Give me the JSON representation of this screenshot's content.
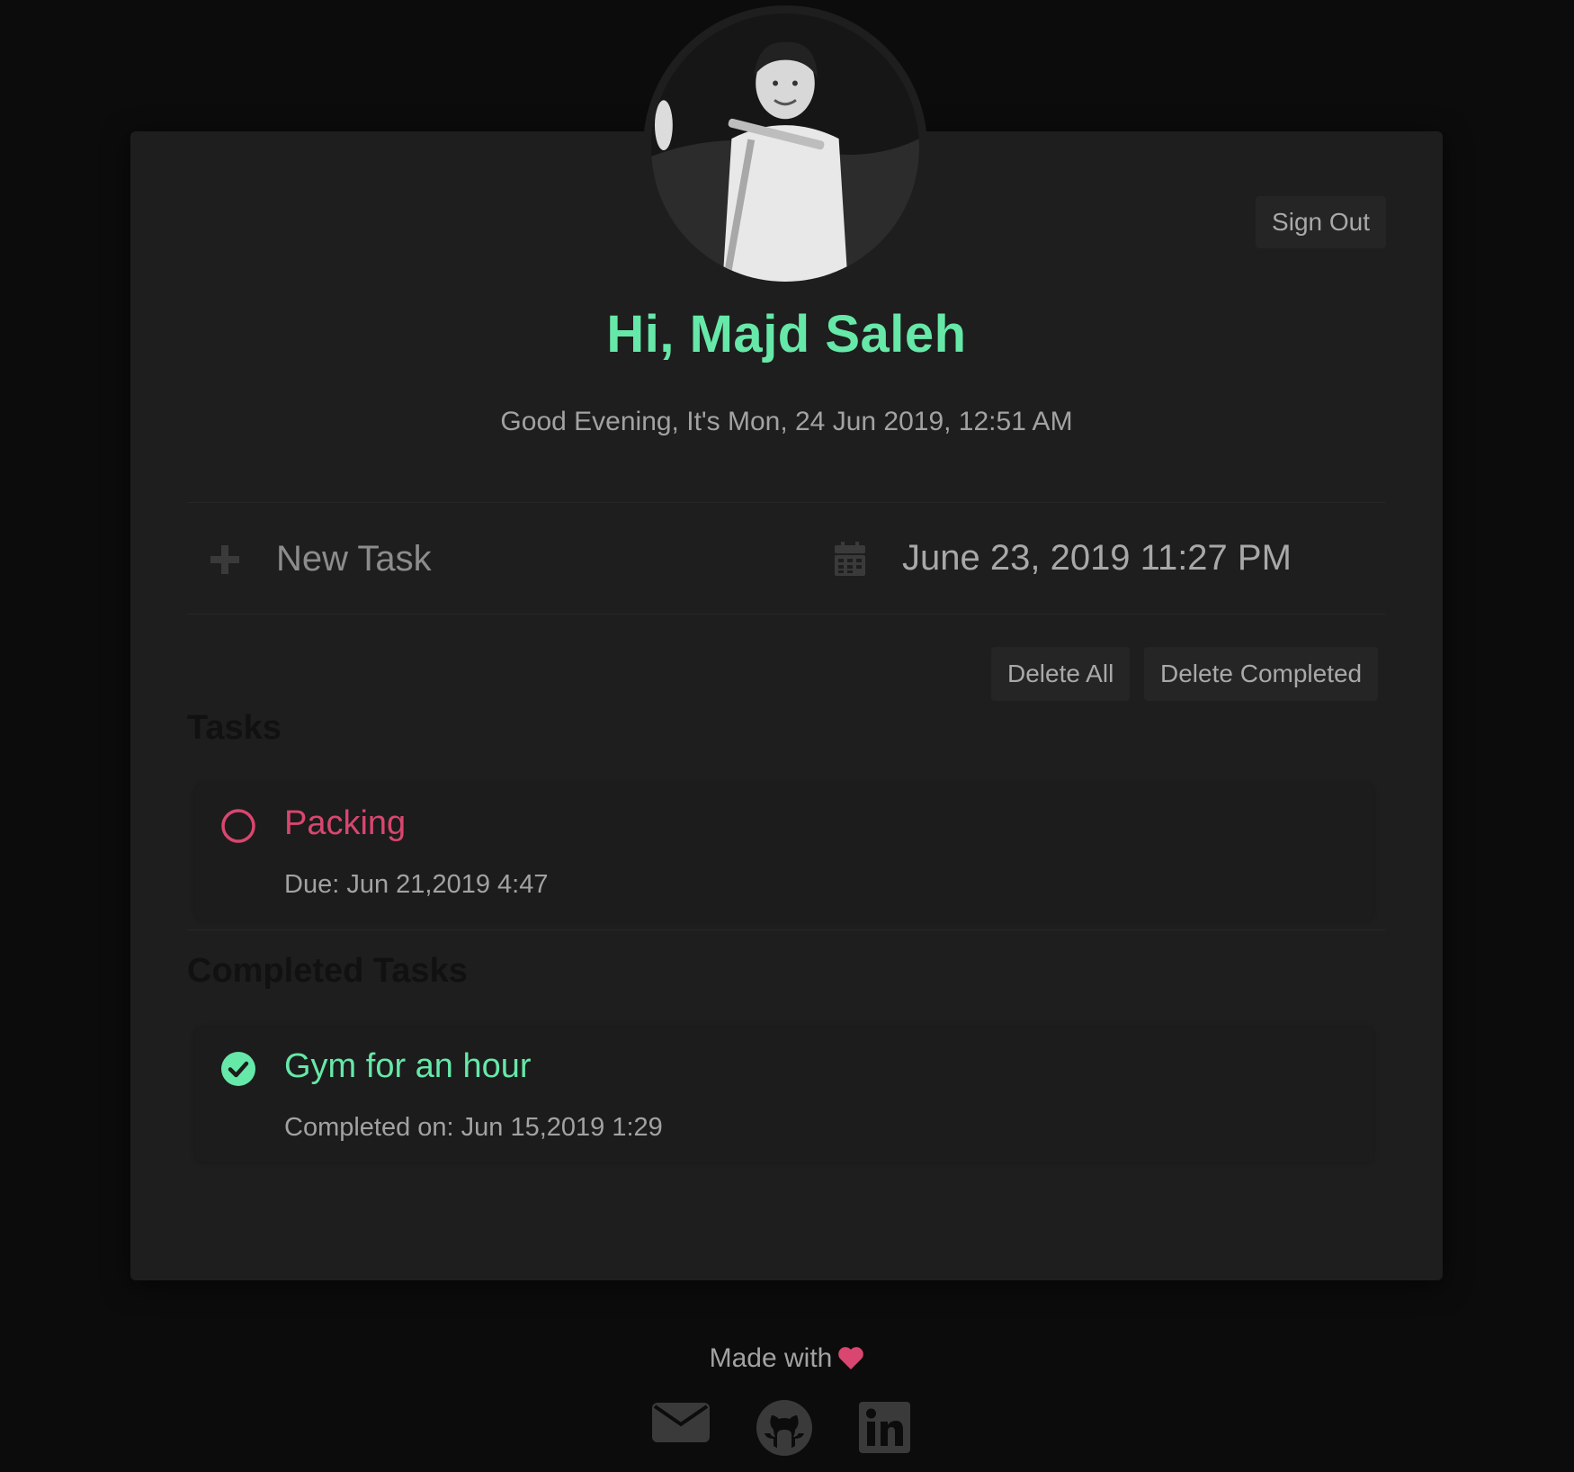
{
  "header": {
    "sign_out_label": "Sign Out",
    "greeting_title": "Hi, Majd Saleh",
    "greeting_sub": "Good Evening, It's Mon, 24 Jun 2019, 12:51 AM"
  },
  "new_task": {
    "placeholder": "New Task",
    "date_value": "June 23, 2019 11:27 PM"
  },
  "actions": {
    "delete_all_label": "Delete All",
    "delete_completed_label": "Delete Completed"
  },
  "tasks": {
    "title": "Tasks",
    "items": [
      {
        "name": "Packing",
        "meta": "Due: Jun 21,2019 4:47"
      }
    ]
  },
  "completed": {
    "title": "Completed Tasks",
    "items": [
      {
        "name": "Gym for an hour",
        "meta": "Completed on: Jun 15,2019 1:29"
      }
    ]
  },
  "footer": {
    "made_with": "Made with"
  },
  "icons": {
    "add": "plus-icon",
    "date": "calendar-icon",
    "pending": "circle-outline-icon",
    "done": "check-circle-icon",
    "heart": "heart-icon",
    "social": [
      "envelope-icon",
      "github-icon",
      "linkedin-icon"
    ]
  },
  "colors": {
    "accent_green": "#66e8a8",
    "accent_pink": "#d9466f",
    "card_bg": "#1e1e1e",
    "page_bg": "#0c0c0c"
  }
}
